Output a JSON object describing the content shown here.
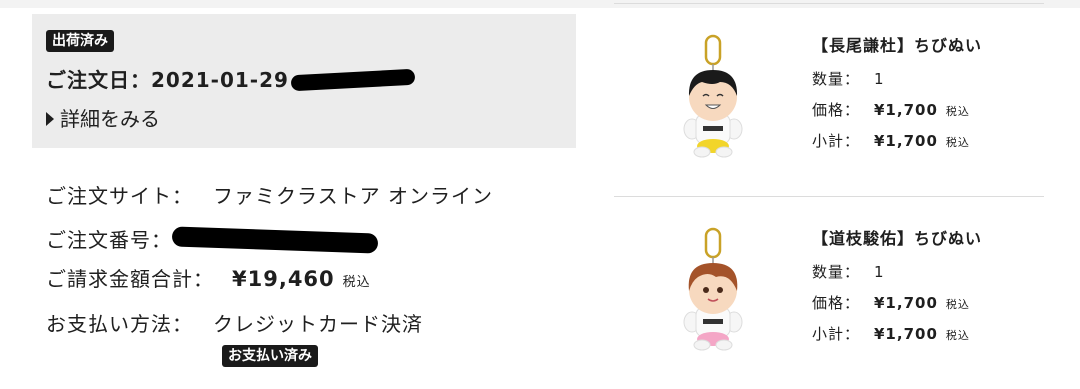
{
  "order": {
    "status_badge": "出荷済み",
    "date_label": "ご注文日：",
    "date_value": "2021-01-29",
    "details_link": "詳細をみる",
    "site_label": "ご注文サイト：",
    "site_value": "ファミクラストア オンライン",
    "number_label": "ご注文番号：",
    "total_label": "ご請求金額合計：",
    "total_value": "¥19,460",
    "tax_note": "税込",
    "payment_label": "お支払い方法：",
    "payment_value": "クレジットカード決済",
    "payment_status_badge": "お支払い済み"
  },
  "items": [
    {
      "title": "【長尾謙杜】ちびぬい",
      "quantity_label": "数量：",
      "quantity_value": "1",
      "price_label": "価格：",
      "price_value": "¥1,700",
      "subtotal_label": "小計：",
      "subtotal_value": "¥1,700",
      "tax_note": "税込",
      "hair_color": "#1a1a1a",
      "pants_color": "#f2d52a"
    },
    {
      "title": "【道枝駿佑】ちびぬい",
      "quantity_label": "数量：",
      "quantity_value": "1",
      "price_label": "価格：",
      "price_value": "¥1,700",
      "subtotal_label": "小計：",
      "subtotal_value": "¥1,700",
      "tax_note": "税込",
      "hair_color": "#a4532a",
      "pants_color": "#f4a6c6"
    }
  ]
}
